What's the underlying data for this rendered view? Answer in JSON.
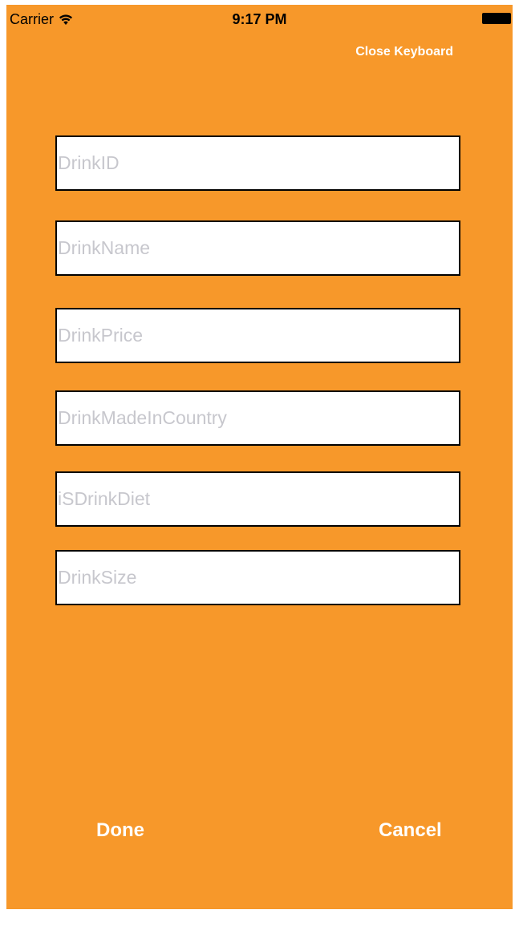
{
  "status_bar": {
    "carrier": "Carrier",
    "time": "9:17 PM",
    "wifi_icon": "wifi-icon",
    "battery_icon": "battery-icon"
  },
  "toolbar": {
    "close_keyboard_label": "Close Keyboard"
  },
  "form": {
    "fields": [
      {
        "placeholder": "DrinkID",
        "value": ""
      },
      {
        "placeholder": "DrinkName",
        "value": ""
      },
      {
        "placeholder": "DrinkPrice",
        "value": ""
      },
      {
        "placeholder": "DrinkMadeInCountry",
        "value": ""
      },
      {
        "placeholder": "iSDrinkDiet",
        "value": ""
      },
      {
        "placeholder": "DrinkSize",
        "value": ""
      }
    ]
  },
  "actions": {
    "done_label": "Done",
    "cancel_label": "Cancel"
  },
  "colors": {
    "background": "#f7982a",
    "field_background": "#ffffff",
    "placeholder_text": "#c7c7cd",
    "button_text": "#ffffff"
  }
}
